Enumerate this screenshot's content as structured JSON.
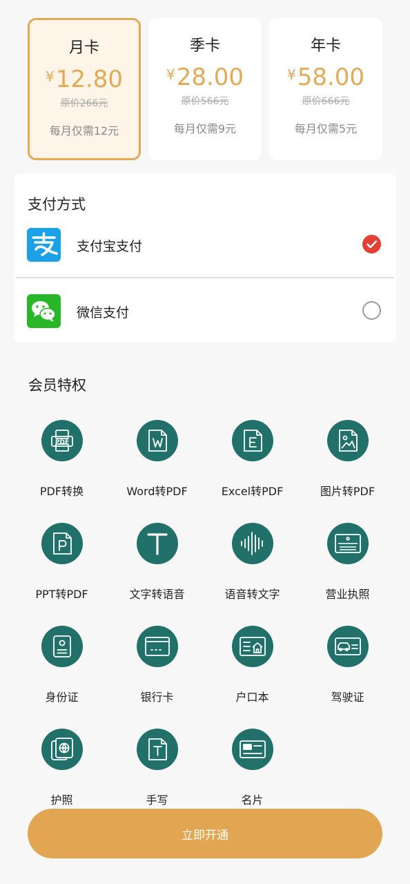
{
  "plans": [
    {
      "name": "月卡",
      "currency": "¥",
      "price": "12.80",
      "original": "原价266元",
      "monthly": "每月仅需12元",
      "selected": true
    },
    {
      "name": "季卡",
      "currency": "¥",
      "price": "28.00",
      "original": "原价566元",
      "monthly": "每月仅需9元",
      "selected": false
    },
    {
      "name": "年卡",
      "currency": "¥",
      "price": "58.00",
      "original": "原价666元",
      "monthly": "每月仅需5元",
      "selected": false
    }
  ],
  "payment": {
    "title": "支付方式",
    "options": [
      {
        "label": "支付宝支付",
        "icon": "alipay-icon",
        "checked": true
      },
      {
        "label": "微信支付",
        "icon": "wechat-icon",
        "checked": false
      }
    ]
  },
  "perks": {
    "title": "会员特权",
    "items": [
      {
        "label": "PDF转换",
        "icon": "pdf-convert-icon"
      },
      {
        "label": "Word转PDF",
        "icon": "word-icon"
      },
      {
        "label": "Excel转PDF",
        "icon": "excel-icon"
      },
      {
        "label": "图片转PDF",
        "icon": "image-icon"
      },
      {
        "label": "PPT转PDF",
        "icon": "ppt-icon"
      },
      {
        "label": "文字转语音",
        "icon": "text-to-speech-icon"
      },
      {
        "label": "语音转文字",
        "icon": "speech-to-text-icon"
      },
      {
        "label": "营业执照",
        "icon": "business-license-icon"
      },
      {
        "label": "身份证",
        "icon": "id-card-icon"
      },
      {
        "label": "银行卡",
        "icon": "bank-card-icon"
      },
      {
        "label": "户口本",
        "icon": "household-register-icon"
      },
      {
        "label": "驾驶证",
        "icon": "driver-license-icon"
      },
      {
        "label": "护照",
        "icon": "passport-icon"
      },
      {
        "label": "手写",
        "icon": "handwriting-icon"
      },
      {
        "label": "名片",
        "icon": "business-card-icon"
      }
    ]
  },
  "cta": {
    "label": "立即开通"
  },
  "colors": {
    "accent": "#e3a957",
    "selected_bg": "#fef4e8",
    "perk_icon_bg": "#21716a",
    "check_red": "#e33f33",
    "alipay_blue": "#1aa1e8",
    "wechat_green": "#2ab629",
    "cta_bg": "#e2a552"
  }
}
